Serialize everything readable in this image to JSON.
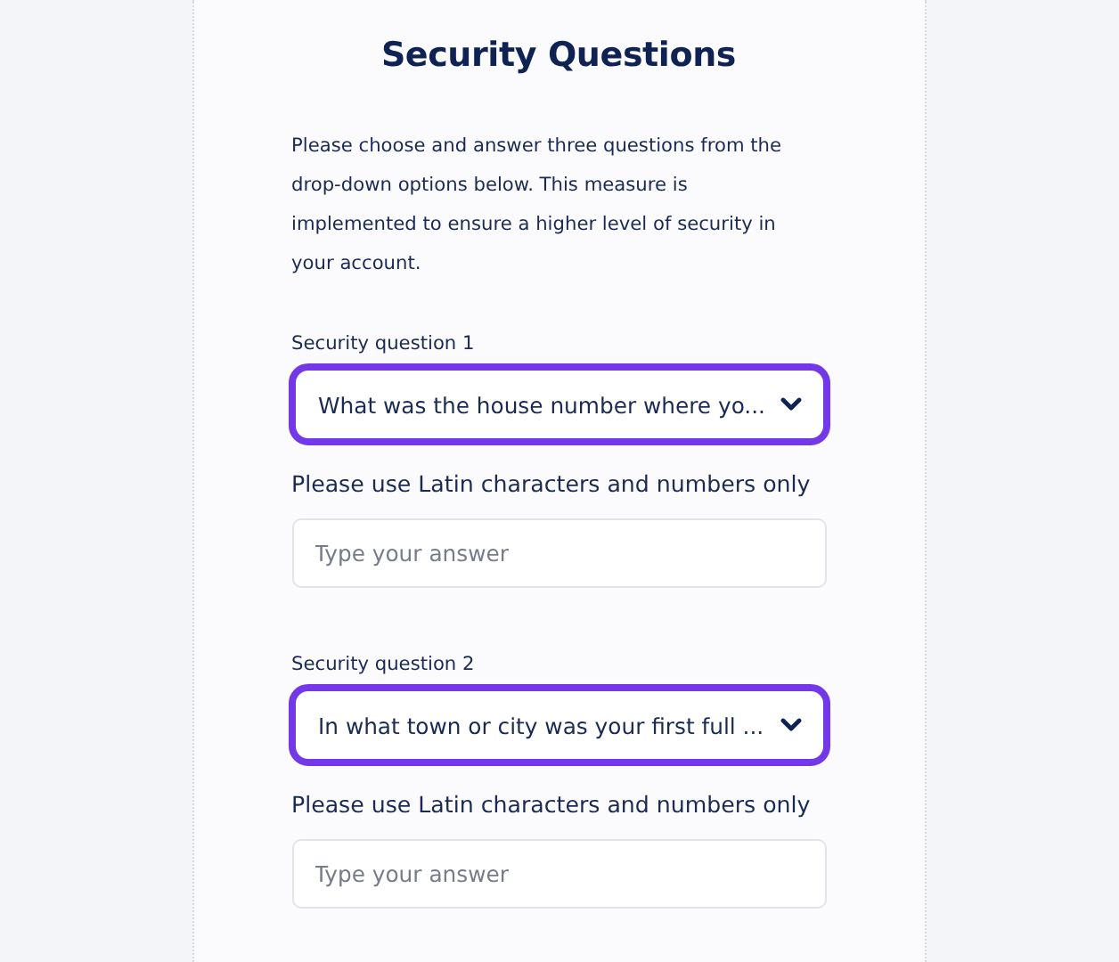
{
  "title": "Security Questions",
  "intro": "Please choose and answer three questions from the drop-down options below. This measure is implemented to ensure a higher level of security in your account.",
  "questions": [
    {
      "label": "Security question 1",
      "selected_question": "What was the house number where yo...",
      "hint": "Please use Latin characters and numbers only",
      "answer": {
        "placeholder": "Type your answer"
      }
    },
    {
      "label": "Security question 2",
      "selected_question": "In what town or city was your first full ...",
      "hint": "Please use Latin characters and numbers only",
      "answer": {
        "placeholder": "Type your answer"
      }
    }
  ]
}
